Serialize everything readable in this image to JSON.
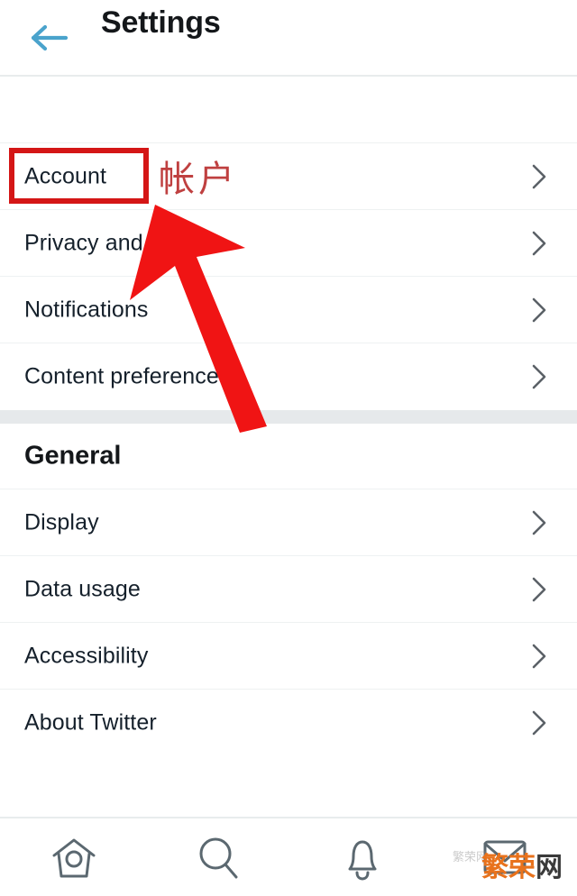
{
  "header": {
    "title": "Settings",
    "back_icon": "back-arrow-icon",
    "back_icon_color": "#4aa3cc"
  },
  "sections": [
    {
      "id": "account",
      "heading": null,
      "rows": [
        {
          "label": "Account",
          "chevron": "chevron-right-icon"
        },
        {
          "label": "Privacy and safety",
          "chevron": "chevron-right-icon"
        },
        {
          "label": "Notifications",
          "chevron": "chevron-right-icon"
        },
        {
          "label": "Content preferences",
          "chevron": "chevron-right-icon"
        }
      ]
    },
    {
      "id": "general",
      "heading": "General",
      "rows": [
        {
          "label": "Display",
          "chevron": "chevron-right-icon"
        },
        {
          "label": "Data usage",
          "chevron": "chevron-right-icon"
        },
        {
          "label": "Accessibility",
          "chevron": "chevron-right-icon"
        },
        {
          "label": "About Twitter",
          "chevron": "chevron-right-icon"
        }
      ]
    }
  ],
  "annotations": {
    "highlight_target": "Account",
    "highlight_color": "#d41616",
    "callout_text": "帐户",
    "callout_color": "#bf4040",
    "arrow_color": "#f01414",
    "arrow_icon": "red-pointer-arrow"
  },
  "bottom_nav": {
    "items": [
      {
        "icon": "home-icon",
        "label": "Home"
      },
      {
        "icon": "search-icon",
        "label": "Search"
      },
      {
        "icon": "bell-icon",
        "label": "Notifications"
      },
      {
        "icon": "envelope-icon",
        "label": "Messages"
      }
    ],
    "icon_color": "#5b6870"
  },
  "watermark": {
    "text_primary": "繁荣",
    "text_secondary": "网",
    "text_faint": "繁荣网",
    "color_primary": "#e8721c",
    "color_secondary": "#3a3a3a"
  }
}
